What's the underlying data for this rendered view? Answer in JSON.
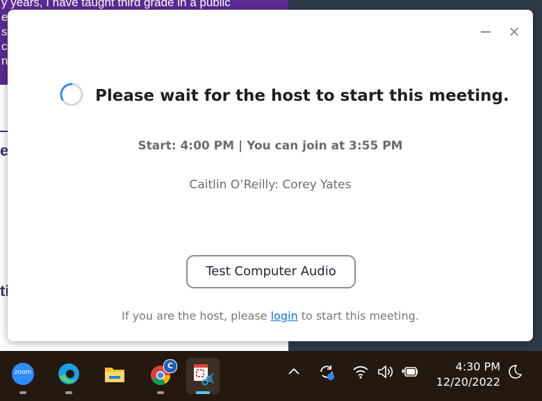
{
  "background_page": {
    "banner_lines": [
      "y years, I have taught third grade in a public",
      "es",
      "s (",
      "ca",
      "nt"
    ],
    "side_letters": [
      "e",
      "ti"
    ],
    "banner_color": "#5b2b93"
  },
  "dialog": {
    "title": "Please wait for the host to start this meeting.",
    "schedule": "Start: 4:00 PM | You can join at 3:55 PM",
    "participants": "Caitlin O’Reilly: Corey Yates",
    "test_audio_button": "Test Computer Audio",
    "host_text_before": "If you are the host, please",
    "host_link": "login",
    "host_text_after": "to start this meeting.",
    "minimize_icon": "minimize-icon",
    "close_icon": "close-icon",
    "spinner_icon": "loading-spinner-icon",
    "link_color": "#0e71eb"
  },
  "taskbar": {
    "apps": [
      {
        "name": "zoom",
        "label": "zoom",
        "active": false
      },
      {
        "name": "edge",
        "active": false
      },
      {
        "name": "file-explorer",
        "active": false
      },
      {
        "name": "chrome",
        "badge": "C",
        "active": false
      },
      {
        "name": "snipping-tool",
        "active": true
      }
    ],
    "tray_icons": [
      "chevron-up-icon",
      "sync-icon",
      "wifi-icon",
      "volume-icon",
      "battery-icon"
    ],
    "time": "4:30 PM",
    "date": "12/20/2022",
    "focus_icon": "moon-icon",
    "accent_color": "#5cc8f5"
  }
}
